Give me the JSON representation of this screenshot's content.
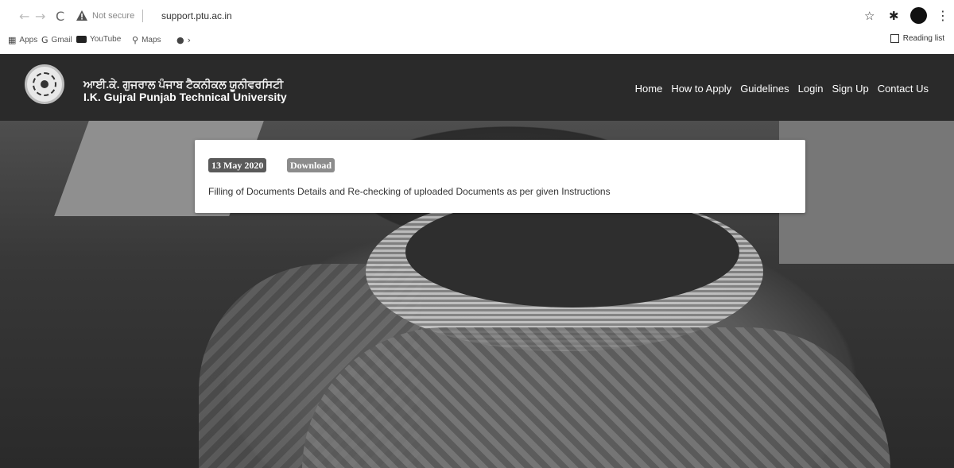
{
  "browser": {
    "security_label": "Not secure",
    "url": "support.ptu.ac.in",
    "bookmarks": [
      {
        "label": "Apps",
        "icon": "apps-grid-icon"
      },
      {
        "label": "Gmail",
        "icon": "gmail-icon"
      },
      {
        "label": "YouTube",
        "icon": "youtube-icon"
      },
      {
        "label": "Maps",
        "icon": "maps-pin-icon"
      }
    ],
    "reading_list_label": "Reading list"
  },
  "site": {
    "name_gurmukhi": "ਆਈ.ਕੇ. ਗੁਜਰਾਲ ਪੰਜਾਬ ਟੈਕਨੀਕਲ ਯੂਨੀਵਰਸਿਟੀ",
    "name": "I.K. Gujral Punjab Technical University",
    "nav": [
      "Home",
      "How to Apply",
      "Guidelines",
      "Login",
      "Sign Up",
      "Contact Us"
    ]
  },
  "notice": {
    "date": "13 May 2020",
    "download_label": "Download",
    "text": "Filling of Documents Details and Re-checking of uploaded Documents as per given Instructions"
  }
}
